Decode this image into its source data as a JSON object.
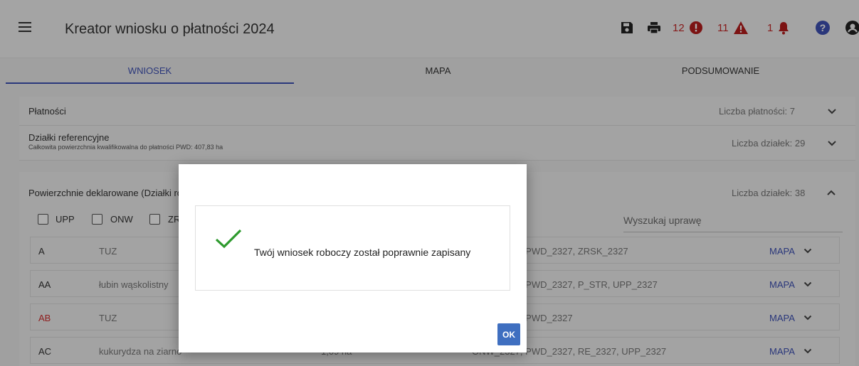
{
  "header": {
    "title": "Kreator wniosku o płatności 2024",
    "errors_count": "12",
    "warnings_count": "11",
    "notifications_count": "1",
    "error_color": "#c62828"
  },
  "tabs": [
    {
      "label": "WNIOSEK",
      "active": true
    },
    {
      "label": "MAPA",
      "active": false
    },
    {
      "label": "PODSUMOWANIE",
      "active": false
    }
  ],
  "payments": {
    "label": "Płatności",
    "count": "Liczba płatności: 7"
  },
  "parcels": {
    "label": "Działki referencyjne",
    "subtitle": "Całkowita powierzchnia kwalifikowalna do płatności PWD: 407,83 ha",
    "count": "Liczba działek: 29"
  },
  "declared": {
    "label": "Powierzchnie deklarowane (Działki rolne)",
    "count": "Liczba działek: 38",
    "filters": [
      "UPP",
      "ONW",
      "ZRSK"
    ],
    "search_placeholder": "Wyszukaj uprawę",
    "rows": [
      {
        "code": "A",
        "crop": "TUZ",
        "area": "",
        "payments": "ONW_2327, PWD_2327, ZRSK_2327",
        "map": "MAPA",
        "code_color": "#333333"
      },
      {
        "code": "AA",
        "crop": "łubin wąskolistny",
        "area": "",
        "payments": "ONW_2327, PWD_2327, P_STR, UPP_2327",
        "map": "MAPA",
        "code_color": "#333333"
      },
      {
        "code": "AB",
        "crop": "TUZ",
        "area": "",
        "payments": "ONW_2327, PWD_2327",
        "map": "MAPA",
        "code_color": "#d32f2f"
      },
      {
        "code": "AC",
        "crop": "kukurydza na ziarno",
        "area": "1,09 ha",
        "payments": "ONW_2327, PWD_2327, RE_2327, UPP_2327",
        "map": "MAPA",
        "code_color": "#333333"
      }
    ]
  },
  "dialog": {
    "message": "Twój wniosek roboczy został poprawnie zapisany",
    "ok_label": "OK",
    "check_color": "#2e9a2e"
  }
}
